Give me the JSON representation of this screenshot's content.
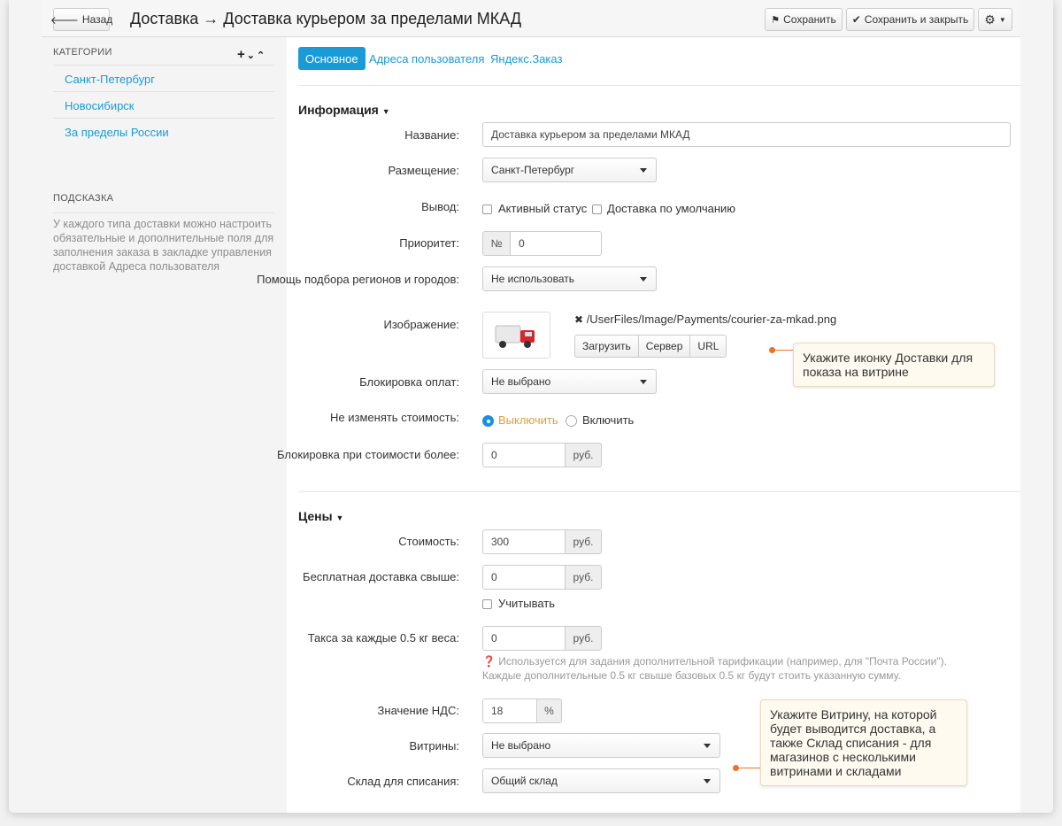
{
  "header": {
    "back_label": "Назад",
    "title": "Доставка → Доставка курьером за пределами МКАД",
    "save_label": "Сохранить",
    "save_close_label": "Сохранить и закрыть"
  },
  "sidebar": {
    "categories_title": "КАТЕГОРИИ",
    "items": [
      {
        "label": "Санкт-Петербург"
      },
      {
        "label": "Новосибирск"
      },
      {
        "label": "За пределы России"
      }
    ],
    "hint_title": "ПОДСКАЗКА",
    "hint_text": "У каждого типа доставки можно настроить обязательные и дополнительные поля для заполнения заказа в закладке управления доставкой Адреса пользователя"
  },
  "tabs": [
    {
      "label": "Основное"
    },
    {
      "label": "Адреса пользователя"
    },
    {
      "label": "Яндекс.Заказ"
    }
  ],
  "info": {
    "section_title": "Информация",
    "name_label": "Название:",
    "name_value": "Доставка курьером за пределами МКАД",
    "placement_label": "Размещение:",
    "placement_value": "Санкт-Петербург",
    "output_label": "Вывод:",
    "active_status_label": "Активный статус",
    "default_delivery_label": "Доставка по умолчанию",
    "priority_label": "Приоритет:",
    "priority_prefix": "№",
    "priority_value": "0",
    "region_help_label": "Помощь подбора регионов и городов:",
    "region_help_value": "Не использовать",
    "image_label": "Изображение:",
    "image_path": "/UserFiles/Image/Payments/courier-za-mkad.png",
    "upload_label": "Загрузить",
    "server_label": "Сервер",
    "url_label": "URL",
    "payment_block_label": "Блокировка оплат:",
    "payment_block_value": "Не выбрано",
    "keep_price_label": "Не изменять стоимость:",
    "disable_label": "Выключить",
    "enable_label": "Включить",
    "block_over_label": "Блокировка при стоимости более:",
    "block_over_value": "0",
    "currency": "руб."
  },
  "prices": {
    "section_title": "Цены",
    "cost_label": "Стоимость:",
    "cost_value": "300",
    "free_over_label": "Бесплатная доставка свыше:",
    "free_over_value": "0",
    "consider_label": "Учитывать",
    "tax_label": "Такса за каждые 0.5 кг веса:",
    "tax_value": "0",
    "tax_note_1": "Используется для задания дополнительной тарификации (например, для \"Почта России\").",
    "tax_note_2": "Каждые дополнительные 0.5 кг свыше базовых 0.5 кг будут стоить указанную сумму.",
    "vat_label": "Значение НДС:",
    "vat_value": "18",
    "vat_unit": "%",
    "showcases_label": "Витрины:",
    "showcases_value": "Не выбрано",
    "warehouse_label": "Склад для списания:",
    "warehouse_value": "Общий склад"
  },
  "callouts": {
    "icon_hint": "Укажите иконку Доставки для показа на витрине",
    "showcase_hint": "Укажите Витрину, на которой будет выводится доставка, а также Склад списания - для магазинов с несколькими витринами и складами"
  },
  "colors": {
    "accent": "#1b9ad8",
    "link": "#1a9ad6",
    "callout_line": "#e8742a",
    "radio_on_text": "#d9a13b"
  }
}
